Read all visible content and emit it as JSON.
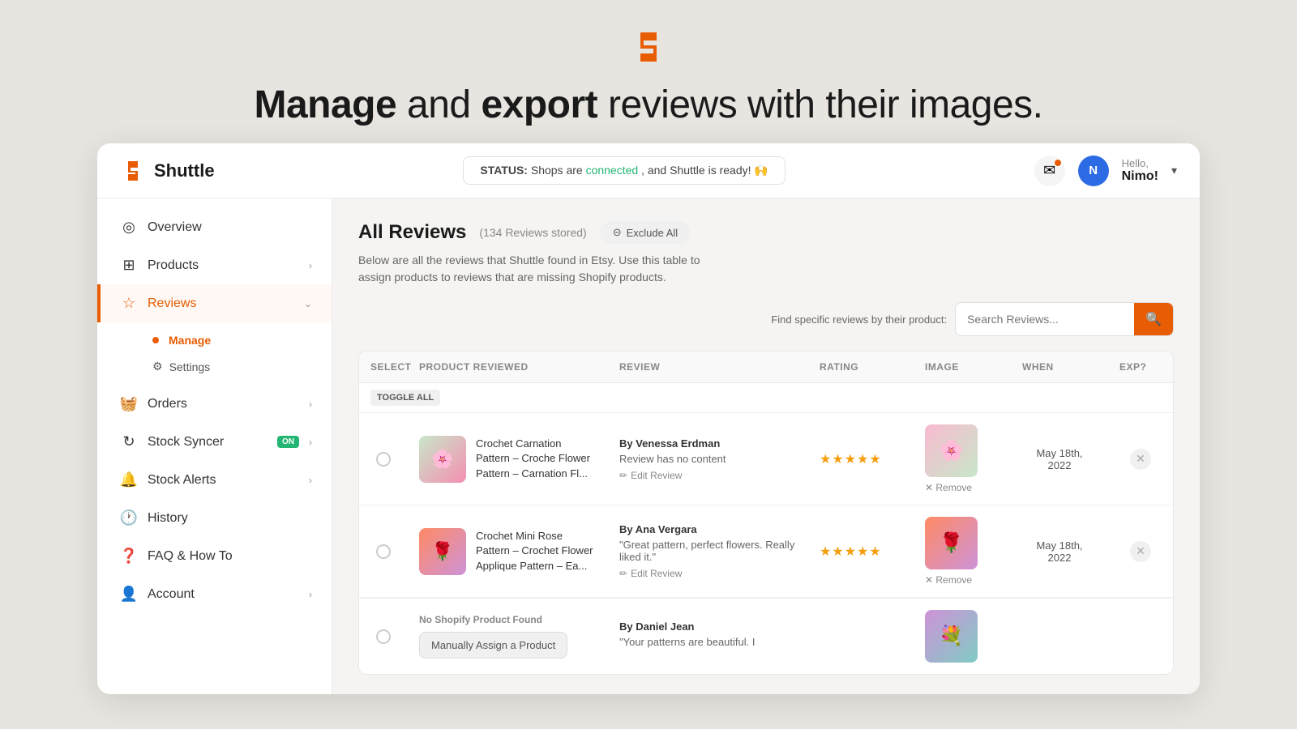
{
  "hero": {
    "title_part1": "Manage",
    "title_and": " and ",
    "title_part2": "export",
    "title_rest": " reviews with their images."
  },
  "header": {
    "brand_name": "Shuttle",
    "status_label": "STATUS:",
    "status_text": " Shops are ",
    "connected_text": "connected",
    "status_rest": ", and Shuttle is ready! 🙌",
    "user_greeting": "Hello,",
    "user_name": "Nimo!",
    "user_initial": "N"
  },
  "sidebar": {
    "items": [
      {
        "label": "Overview",
        "icon": "❓",
        "id": "overview",
        "chevron": false
      },
      {
        "label": "Products",
        "icon": "🛒",
        "id": "products",
        "chevron": true
      },
      {
        "label": "Reviews",
        "icon": "⭐",
        "id": "reviews",
        "chevron": true,
        "active": true
      },
      {
        "label": "Orders",
        "icon": "📦",
        "id": "orders",
        "chevron": true
      },
      {
        "label": "Stock Syncer",
        "icon": "🔄",
        "id": "stock-syncer",
        "chevron": true,
        "badge": "ON"
      },
      {
        "label": "Stock Alerts",
        "icon": "🔔",
        "id": "stock-alerts",
        "chevron": true
      },
      {
        "label": "History",
        "icon": "🕐",
        "id": "history",
        "chevron": false
      },
      {
        "label": "FAQ & How To",
        "icon": "❓",
        "id": "faq",
        "chevron": false
      },
      {
        "label": "Account",
        "icon": "👤",
        "id": "account",
        "chevron": true
      }
    ],
    "reviews_sub": [
      {
        "label": "Manage",
        "id": "manage",
        "active": true
      },
      {
        "label": "Settings",
        "id": "settings"
      }
    ]
  },
  "main": {
    "title": "All Reviews",
    "count": "(134 Reviews stored)",
    "exclude_btn": "Exclude All",
    "description_line1": "Below are all the reviews that Shuttle found in Etsy. Use this table to",
    "description_line2": "assign products to reviews that are missing Shopify products.",
    "search_label": "Find specific reviews by their product:",
    "search_placeholder": "Search Reviews...",
    "table_headers": {
      "select": "SELECT",
      "product": "PRODUCT REVIEWED",
      "review": "REVIEW",
      "rating": "RATING",
      "image": "IMAGE",
      "when": "WHEN",
      "exp": "EXP?"
    },
    "toggle_all": "TOGGLE ALL",
    "rows": [
      {
        "id": "row1",
        "product_name": "Crochet Carnation Pattern – Croche Flower Pattern – Carnation Fl...",
        "reviewer": "By Venessa Erdman",
        "review_text": "Review has no content",
        "stars": 5,
        "when": "May 18th, 2022",
        "has_image": true,
        "image_emoji": "🌸"
      },
      {
        "id": "row2",
        "product_name": "Crochet Mini Rose Pattern – Crochet Flower Applique Pattern – Ea...",
        "reviewer": "By Ana Vergara",
        "review_text": "\"Great pattern, perfect flowers. Really liked it.\"",
        "stars": 5,
        "when": "May 18th, 2022",
        "has_image": true,
        "image_emoji": "🌹"
      },
      {
        "id": "row3",
        "product_name": "No Shopify Product Found",
        "reviewer": "By Daniel Jean",
        "review_text": "\"Your patterns are beautiful. I",
        "stars": 0,
        "when": "",
        "has_image": true,
        "image_emoji": "💐",
        "no_product": true
      }
    ],
    "edit_review": "✏ Edit Review",
    "remove": "✕ Remove",
    "assign_btn": "Manually Assign a Product"
  }
}
